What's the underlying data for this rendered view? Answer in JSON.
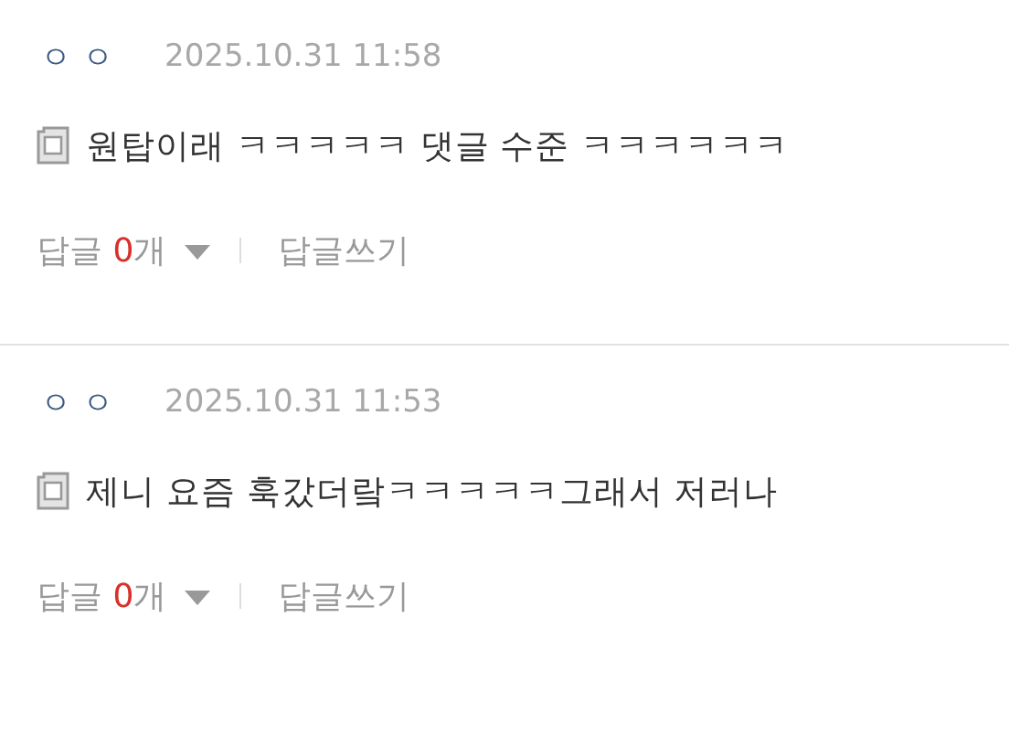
{
  "comments": [
    {
      "author": "ㅇㅇ",
      "date": "2025.10.31 11:58",
      "text": "원탑이래 ㅋㅋㅋㅋㅋ 댓글 수준 ㅋㅋㅋㅋㅋㅋ",
      "reply_label": "답글",
      "reply_count": "0",
      "reply_unit": "개",
      "write_reply": "답글쓰기"
    },
    {
      "author": "ㅇㅇ",
      "date": "2025.10.31 11:53",
      "text": "제니 요즘 훅갔더랔ㅋㅋㅋㅋㅋ그래서 저러나",
      "reply_label": "답글",
      "reply_count": "0",
      "reply_unit": "개",
      "write_reply": "답글쓰기"
    }
  ]
}
